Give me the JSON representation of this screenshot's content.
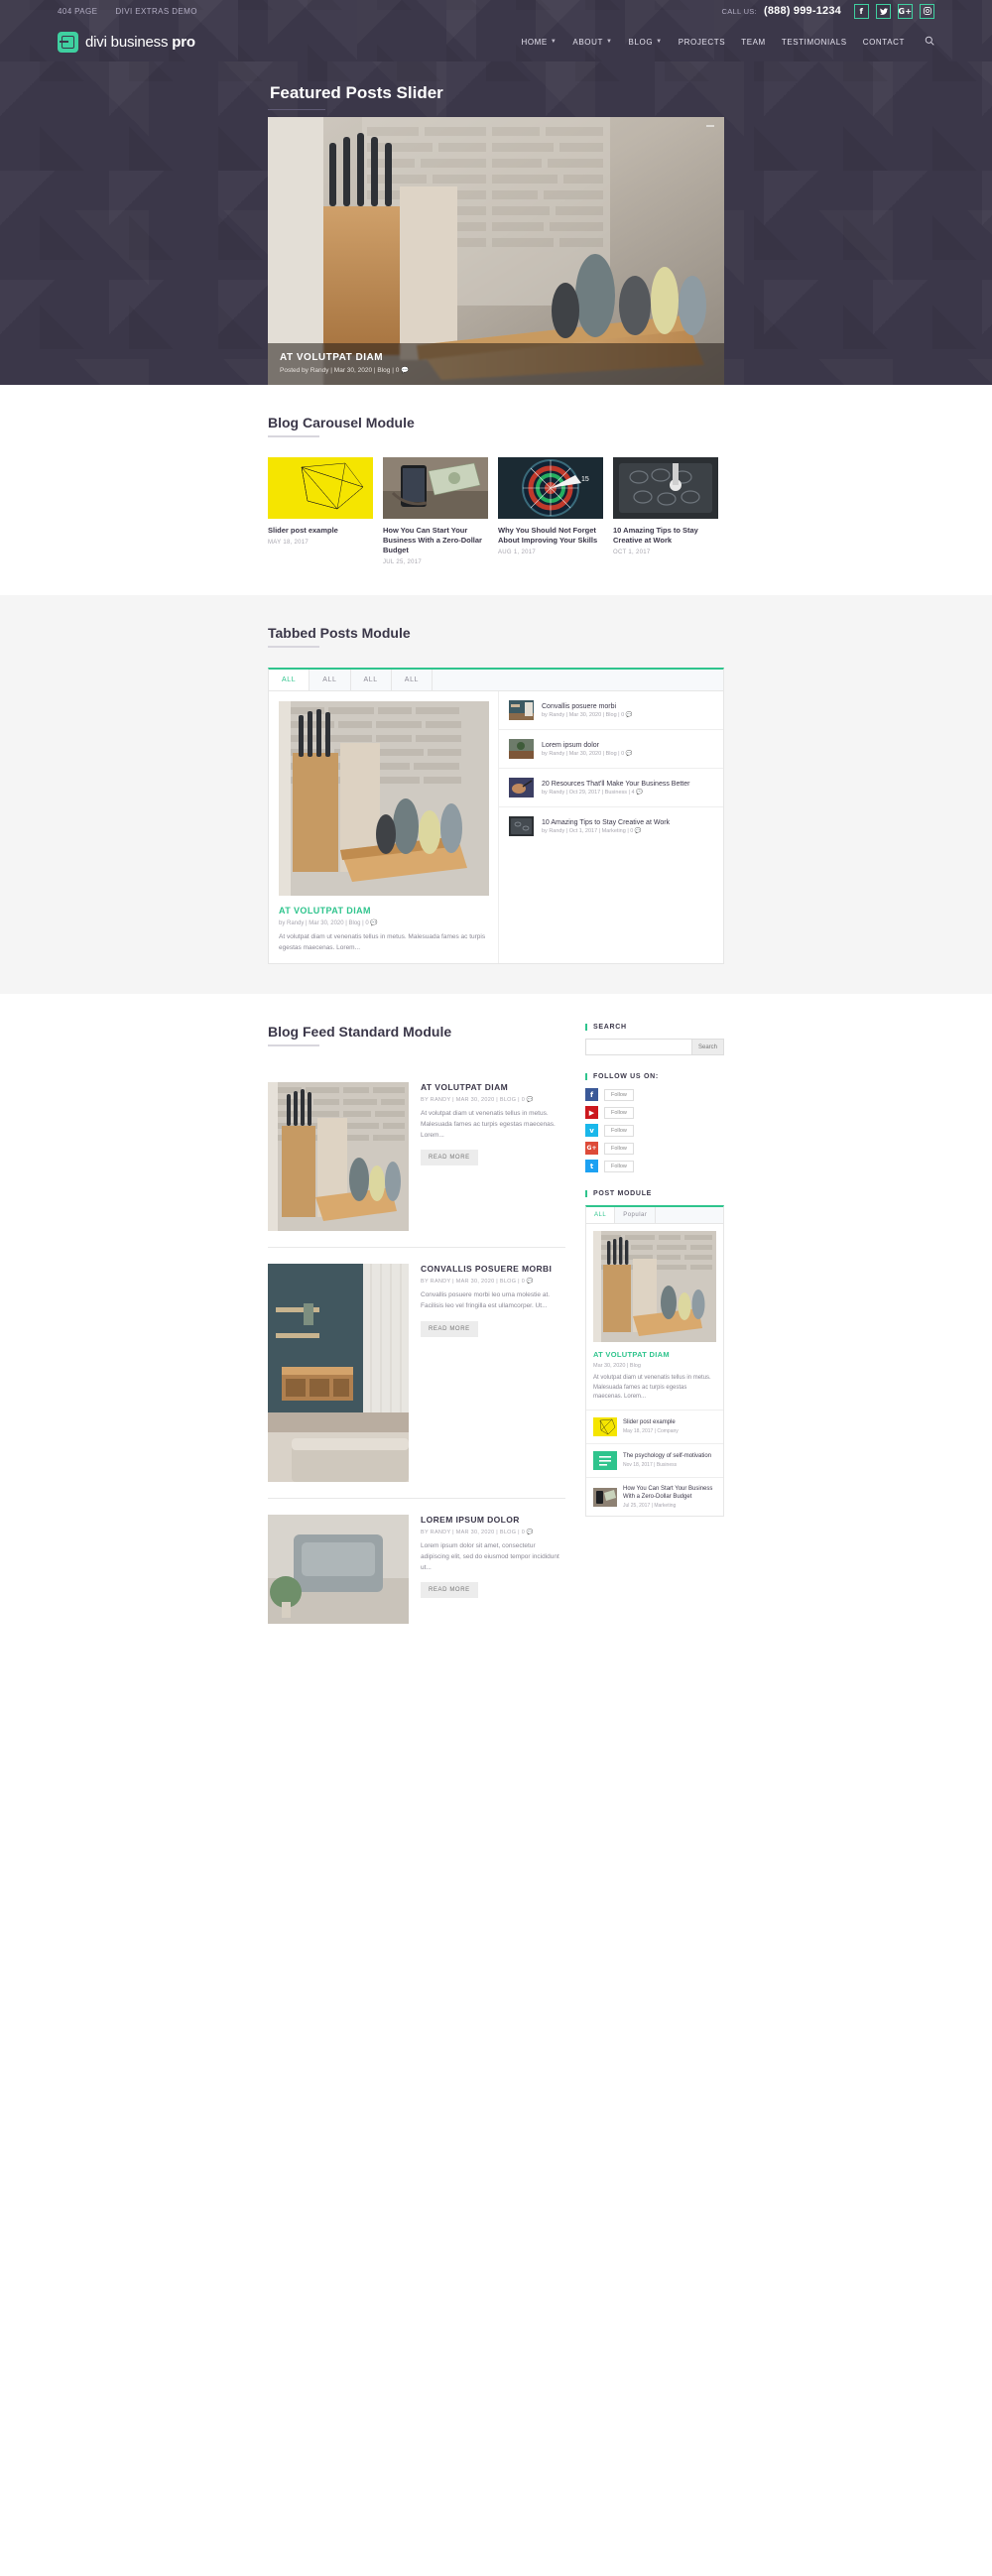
{
  "topbar": {
    "links": [
      "404 PAGE",
      "DIVI EXTRAS DEMO"
    ],
    "call_label": "CALL US:",
    "phone": "(888) 999-1234",
    "socials": [
      "facebook-icon",
      "twitter-icon",
      "google-plus-icon",
      "instagram-icon"
    ],
    "social_glyphs": [
      "f",
      "ᵗ",
      "G+",
      "□"
    ]
  },
  "brand": {
    "name_light": "divi business ",
    "name_bold": "pro"
  },
  "nav": {
    "items": [
      {
        "label": "HOME",
        "has_dropdown": true
      },
      {
        "label": "ABOUT",
        "has_dropdown": true
      },
      {
        "label": "BLOG",
        "has_dropdown": true
      },
      {
        "label": "PROJECTS",
        "has_dropdown": false
      },
      {
        "label": "TEAM",
        "has_dropdown": false
      },
      {
        "label": "TESTIMONIALS",
        "has_dropdown": false
      },
      {
        "label": "CONTACT",
        "has_dropdown": false
      }
    ],
    "search_icon": "search-icon"
  },
  "hero": {
    "title": "Featured Posts Slider",
    "slide": {
      "title": "AT VOLUTPAT DIAM",
      "meta": "Posted by Randy | Mar 30, 2020 | Blog | 0 💬"
    }
  },
  "carousel": {
    "title": "Blog Carousel Module",
    "items": [
      {
        "title": "Slider post example",
        "date": "MAY 18, 2017"
      },
      {
        "title": "How You Can Start Your Business With a Zero-Dollar Budget",
        "date": "JUL 25, 2017"
      },
      {
        "title": "Why You Should Not Forget About Improving Your Skills",
        "date": "AUG 1, 2017"
      },
      {
        "title": "10 Amazing Tips to Stay Creative at Work",
        "date": "OCT 1, 2017"
      }
    ]
  },
  "tabbed": {
    "title": "Tabbed Posts Module",
    "tabs": [
      "ALL",
      "ALL",
      "ALL",
      "ALL"
    ],
    "active_tab": 0,
    "featured": {
      "title": "AT VOLUTPAT DIAM",
      "meta": "by Randy | Mar 30, 2020 | Blog | 0 💬",
      "excerpt": "At volutpat diam ut venenatis tellus in metus. Malesuada fames ac turpis egestas maecenas. Lorem..."
    },
    "list": [
      {
        "title": "Convallis posuere morbi",
        "meta": "by Randy | Mar 30, 2020 | Blog | 0 💬"
      },
      {
        "title": "Lorem ipsum dolor",
        "meta": "by Randy | Mar 30, 2020 | Blog | 0 💬"
      },
      {
        "title": "20 Resources That'll Make Your Business Better",
        "meta": "by Randy | Oct 29, 2017 | Business | 4 💬"
      },
      {
        "title": "10 Amazing Tips to Stay Creative at Work",
        "meta": "by Randy | Oct 1, 2017 | Marketing | 0 💬"
      }
    ]
  },
  "feed": {
    "title": "Blog Feed Standard Module",
    "read_more": "READ MORE",
    "posts": [
      {
        "title": "AT VOLUTPAT DIAM",
        "meta": "BY RANDY | MAR 30, 2020 | BLOG | 0 💬",
        "excerpt": "At volutpat diam ut venenatis tellus in metus. Malesuada fames ac turpis egestas maecenas. Lorem..."
      },
      {
        "title": "CONVALLIS POSUERE MORBI",
        "meta": "BY RANDY | MAR 30, 2020 | BLOG | 0 💬",
        "excerpt": "Convallis posuere morbi leo urna molestie at. Facilisis leo vel fringilla est ullamcorper. Ut..."
      },
      {
        "title": "LOREM IPSUM DOLOR",
        "meta": "BY RANDY | MAR 30, 2020 | BLOG | 0 💬",
        "excerpt": "Lorem ipsum dolor sit amet, consectetur adipiscing elit, sed do eiusmod tempor incididunt ut..."
      }
    ]
  },
  "sidebar": {
    "search": {
      "heading": "SEARCH",
      "value": "",
      "placeholder": "",
      "button": "Search"
    },
    "follow": {
      "heading": "FOLLOW US ON:",
      "rows": [
        {
          "icon": "facebook-icon",
          "glyph": "f",
          "color": "#3b5998",
          "label": "Follow"
        },
        {
          "icon": "youtube-icon",
          "glyph": "▶",
          "color": "#cc181e",
          "label": "Follow"
        },
        {
          "icon": "vimeo-icon",
          "glyph": "v",
          "color": "#1ab7ea",
          "label": "Follow"
        },
        {
          "icon": "google-plus-icon",
          "glyph": "G+",
          "color": "#dd4b39",
          "label": "Follow"
        },
        {
          "icon": "twitter-icon",
          "glyph": "t",
          "color": "#1da1f2",
          "label": "Follow"
        }
      ]
    },
    "post_module": {
      "heading": "POST MODULE",
      "tabs": [
        "ALL",
        "Popular"
      ],
      "active_tab": 0,
      "feature": {
        "title": "AT VOLUTPAT DIAM",
        "meta": "Mar 30, 2020 | Blog",
        "excerpt": "At volutpat diam ut venenatis tellus in metus. Malesuada fames ac turpis egestas maecenas. Lorem..."
      },
      "items": [
        {
          "title": "Slider post example",
          "meta": "May 18, 2017 | Company"
        },
        {
          "title": "The psychology of self-motivation",
          "meta": "Nov 18, 2017 | Business"
        },
        {
          "title": "How You Can Start Your Business With a Zero-Dollar Budget",
          "meta": "Jul 25, 2017 | Marketing"
        }
      ]
    }
  },
  "colors": {
    "accent": "#2fc48d",
    "dark": "#3b3749",
    "muted": "#a9a7b0"
  }
}
